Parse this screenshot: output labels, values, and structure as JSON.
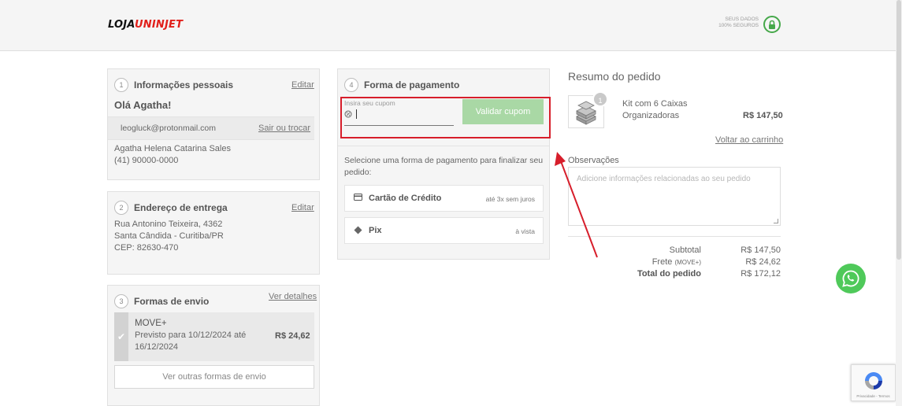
{
  "header": {
    "logo_a": "LOJA",
    "logo_b": "UNINJET",
    "secure_line1": "SEUS DADOS",
    "secure_line2": "100% SEGUROS",
    "lock_icon": "lock-icon",
    "accent": "#46a84a"
  },
  "personal": {
    "step": "1",
    "title": "Informações pessoais",
    "edit": "Editar",
    "greeting": "Olá Agatha!",
    "email": "leogluck@protonmail.com",
    "switch": "Sair ou trocar",
    "name": "Agatha Helena Catarina Sales",
    "phone": "(41) 90000-0000"
  },
  "address": {
    "step": "2",
    "title": "Endereço de entrega",
    "edit": "Editar",
    "line1": "Rua Antonino Teixeira, 4362",
    "line2": "Santa Cândida - Curitiba/PR",
    "line3": "CEP: 82630-470"
  },
  "shipping": {
    "step": "3",
    "title": "Formas de envio",
    "details": "Ver detalhes",
    "option_name": "MOVE+",
    "option_eta1": "Previsto para 10/12/2024 até",
    "option_eta2": "16/12/2024",
    "option_price": "R$ 24,62",
    "other": "Ver outras formas de envio"
  },
  "payment": {
    "step": "4",
    "title": "Forma de pagamento",
    "coupon_label": "Insira seu cupom",
    "coupon_button": "Validar cupom",
    "select_text1": "Selecione uma forma de pagamento para finalizar seu",
    "select_text2": "pedido:",
    "options": [
      {
        "name": "Cartão de Crédito",
        "note": "até 3x sem juros",
        "icon": "credit-card-icon"
      },
      {
        "name": "Pix",
        "note": "à vista",
        "icon": "pix-icon"
      }
    ],
    "highlight_color": "#d71e2b",
    "button_color": "#a9d8a5"
  },
  "summary": {
    "title": "Resumo do pedido",
    "qty": "1",
    "product_line1": "Kit com 6 Caixas",
    "product_line2": "Organizadoras",
    "product_price": "R$ 147,50",
    "back_to_cart": "Voltar ao carrinho",
    "notes_label": "Observações",
    "notes_placeholder": "Adicione informações relacionadas ao seu pedido",
    "subtotal_label": "Subtotal",
    "subtotal": "R$ 147,50",
    "shipping_label": "Frete",
    "shipping_method": "(MOVE+)",
    "shipping": "R$ 24,62",
    "total_label": "Total do pedido",
    "total": "R$ 172,12"
  },
  "widgets": {
    "whatsapp_icon": "whatsapp-icon",
    "recaptcha_text": "Privacidade - Termos"
  }
}
